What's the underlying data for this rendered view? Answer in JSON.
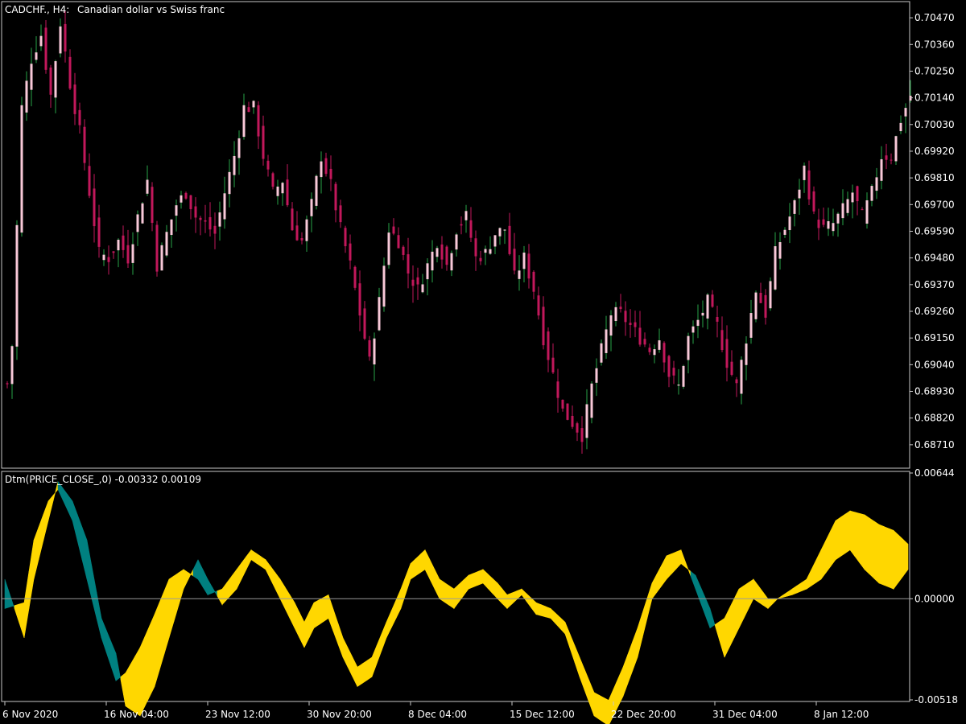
{
  "header": {
    "symbol": "CADCHF., H4:",
    "description": "Canadian dollar vs Swiss franc"
  },
  "indicator": {
    "label": "Dtm(PRICE_CLOSE_,0) -0.00332 0.00109"
  },
  "colors": {
    "background": "#000000",
    "frame": "#c8c8c8",
    "bull_candle": "#27a348",
    "bear_candle": "#c2185b",
    "doji_wick": "#f8c8d8",
    "fill_up": "#ffd700",
    "fill_down": "#008080",
    "zero_line": "#9a9a9a"
  },
  "chart_data": [
    {
      "type": "candlestick",
      "name": "price",
      "y_ticks": [
        "0.70470",
        "0.70360",
        "0.70250",
        "0.70140",
        "0.70030",
        "0.69920",
        "0.69810",
        "0.69700",
        "0.69590",
        "0.69480",
        "0.69370",
        "0.69260",
        "0.69150",
        "0.69040",
        "0.68930",
        "0.68820",
        "0.68710"
      ],
      "ylim": [
        0.6862,
        0.7053
      ],
      "close_path": [
        [
          0,
          0.6896
        ],
        [
          1,
          0.6912
        ],
        [
          3,
          0.701
        ],
        [
          5,
          0.703
        ],
        [
          7,
          0.704
        ],
        [
          9,
          0.7015
        ],
        [
          11,
          0.7045
        ],
        [
          13,
          0.702
        ],
        [
          15,
          0.7
        ],
        [
          17,
          0.6975
        ],
        [
          19,
          0.695
        ],
        [
          21,
          0.6948
        ],
        [
          23,
          0.6955
        ],
        [
          25,
          0.6948
        ],
        [
          27,
          0.6965
        ],
        [
          29,
          0.698
        ],
        [
          31,
          0.6945
        ],
        [
          33,
          0.6958
        ],
        [
          35,
          0.697
        ],
        [
          37,
          0.6975
        ],
        [
          39,
          0.6965
        ],
        [
          41,
          0.6962
        ],
        [
          43,
          0.6958
        ],
        [
          45,
          0.6975
        ],
        [
          47,
          0.699
        ],
        [
          49,
          0.701
        ],
        [
          51,
          0.701
        ],
        [
          53,
          0.699
        ],
        [
          55,
          0.6975
        ],
        [
          57,
          0.698
        ],
        [
          59,
          0.696
        ],
        [
          61,
          0.6955
        ],
        [
          63,
          0.697
        ],
        [
          65,
          0.699
        ],
        [
          67,
          0.6978
        ],
        [
          69,
          0.696
        ],
        [
          71,
          0.6945
        ],
        [
          73,
          0.6925
        ],
        [
          75,
          0.6905
        ],
        [
          77,
          0.693
        ],
        [
          79,
          0.696
        ],
        [
          81,
          0.6955
        ],
        [
          83,
          0.6942
        ],
        [
          85,
          0.6935
        ],
        [
          87,
          0.6945
        ],
        [
          89,
          0.6955
        ],
        [
          91,
          0.6945
        ],
        [
          93,
          0.696
        ],
        [
          95,
          0.6965
        ],
        [
          97,
          0.6948
        ],
        [
          99,
          0.695
        ],
        [
          101,
          0.6958
        ],
        [
          103,
          0.696
        ],
        [
          105,
          0.694
        ],
        [
          107,
          0.6948
        ],
        [
          109,
          0.6935
        ],
        [
          111,
          0.6915
        ],
        [
          113,
          0.69
        ],
        [
          115,
          0.6885
        ],
        [
          117,
          0.688
        ],
        [
          119,
          0.6875
        ],
        [
          121,
          0.6895
        ],
        [
          123,
          0.691
        ],
        [
          125,
          0.6925
        ],
        [
          127,
          0.6925
        ],
        [
          129,
          0.692
        ],
        [
          131,
          0.6915
        ],
        [
          133,
          0.691
        ],
        [
          135,
          0.6915
        ],
        [
          137,
          0.69
        ],
        [
          139,
          0.6895
        ],
        [
          141,
          0.6915
        ],
        [
          143,
          0.6922
        ],
        [
          145,
          0.693
        ],
        [
          147,
          0.692
        ],
        [
          149,
          0.6905
        ],
        [
          151,
          0.6895
        ],
        [
          153,
          0.6915
        ],
        [
          155,
          0.6935
        ],
        [
          157,
          0.6925
        ],
        [
          159,
          0.695
        ],
        [
          161,
          0.696
        ],
        [
          163,
          0.697
        ],
        [
          165,
          0.6985
        ],
        [
          167,
          0.6965
        ],
        [
          169,
          0.696
        ],
        [
          171,
          0.6962
        ],
        [
          173,
          0.6968
        ],
        [
          175,
          0.6975
        ],
        [
          177,
          0.6965
        ],
        [
          179,
          0.6975
        ],
        [
          181,
          0.699
        ],
        [
          183,
          0.699
        ],
        [
          185,
          0.7005
        ],
        [
          187,
          0.7015
        ]
      ]
    },
    {
      "type": "area",
      "name": "Dtm",
      "y_ticks": [
        "0.00644",
        "0.00000",
        "-0.00518"
      ],
      "ylim": [
        -0.00518,
        0.00644
      ],
      "line_a": [
        [
          0,
          -0.0005
        ],
        [
          4,
          -0.0002
        ],
        [
          6,
          0.003
        ],
        [
          9,
          0.005
        ],
        [
          11,
          0.0056
        ],
        [
          14,
          0.004
        ],
        [
          17,
          0.001
        ],
        [
          20,
          -0.002
        ],
        [
          23,
          -0.0042
        ],
        [
          25,
          -0.0038
        ],
        [
          28,
          -0.0025
        ],
        [
          31,
          -0.0008
        ],
        [
          34,
          0.001
        ],
        [
          37,
          0.0015
        ],
        [
          40,
          0.001
        ],
        [
          42,
          0.0002
        ],
        [
          45,
          0.0005
        ],
        [
          48,
          0.0015
        ],
        [
          51,
          0.0025
        ],
        [
          54,
          0.002
        ],
        [
          57,
          0.001
        ],
        [
          60,
          -0.0002
        ],
        [
          62,
          -0.0012
        ],
        [
          64,
          -0.0002
        ],
        [
          67,
          0.0002
        ],
        [
          70,
          -0.002
        ],
        [
          73,
          -0.0035
        ],
        [
          76,
          -0.003
        ],
        [
          79,
          -0.0012
        ],
        [
          82,
          0.0005
        ],
        [
          84,
          0.0018
        ],
        [
          87,
          0.0025
        ],
        [
          90,
          0.001
        ],
        [
          93,
          0.0005
        ],
        [
          96,
          0.0012
        ],
        [
          99,
          0.0015
        ],
        [
          102,
          0.0008
        ],
        [
          104,
          0.0002
        ],
        [
          107,
          0.0005
        ],
        [
          110,
          -0.0002
        ],
        [
          113,
          -0.0005
        ],
        [
          116,
          -0.0012
        ],
        [
          119,
          -0.003
        ],
        [
          122,
          -0.0048
        ],
        [
          125,
          -0.0052
        ],
        [
          128,
          -0.0035
        ],
        [
          131,
          -0.0015
        ],
        [
          134,
          0.0008
        ],
        [
          137,
          0.0022
        ],
        [
          140,
          0.0025
        ],
        [
          143,
          0.0005
        ],
        [
          146,
          -0.0015
        ],
        [
          149,
          -0.001
        ],
        [
          152,
          0.0005
        ],
        [
          155,
          0.001
        ],
        [
          158,
          0.0
        ],
        [
          160,
          0.0
        ],
        [
          163,
          0.0005
        ],
        [
          166,
          0.001
        ],
        [
          169,
          0.0025
        ],
        [
          172,
          0.004
        ],
        [
          175,
          0.0045
        ],
        [
          178,
          0.0043
        ],
        [
          181,
          0.0038
        ],
        [
          184,
          0.0035
        ],
        [
          187,
          0.0028
        ]
      ],
      "line_b": [
        [
          0,
          0.001
        ],
        [
          4,
          -0.002
        ],
        [
          6,
          0.001
        ],
        [
          9,
          0.004
        ],
        [
          11,
          0.006
        ],
        [
          14,
          0.005
        ],
        [
          17,
          0.003
        ],
        [
          20,
          -0.001
        ],
        [
          23,
          -0.0028
        ],
        [
          25,
          -0.0055
        ],
        [
          28,
          -0.006
        ],
        [
          31,
          -0.0045
        ],
        [
          34,
          -0.002
        ],
        [
          37,
          0.0005
        ],
        [
          40,
          0.002
        ],
        [
          42,
          0.001
        ],
        [
          45,
          -0.0003
        ],
        [
          48,
          0.0005
        ],
        [
          51,
          0.002
        ],
        [
          54,
          0.0015
        ],
        [
          57,
          0.0
        ],
        [
          60,
          -0.0015
        ],
        [
          62,
          -0.0025
        ],
        [
          64,
          -0.0015
        ],
        [
          67,
          -0.001
        ],
        [
          70,
          -0.003
        ],
        [
          73,
          -0.0045
        ],
        [
          76,
          -0.004
        ],
        [
          79,
          -0.002
        ],
        [
          82,
          -0.0005
        ],
        [
          84,
          0.001
        ],
        [
          87,
          0.0015
        ],
        [
          90,
          0.0
        ],
        [
          93,
          -0.0005
        ],
        [
          96,
          0.0005
        ],
        [
          99,
          0.0008
        ],
        [
          102,
          0.0
        ],
        [
          104,
          -0.0005
        ],
        [
          107,
          0.0002
        ],
        [
          110,
          -0.0008
        ],
        [
          113,
          -0.001
        ],
        [
          116,
          -0.0018
        ],
        [
          119,
          -0.004
        ],
        [
          122,
          -0.006
        ],
        [
          125,
          -0.0065
        ],
        [
          128,
          -0.005
        ],
        [
          131,
          -0.003
        ],
        [
          134,
          0.0
        ],
        [
          137,
          0.001
        ],
        [
          140,
          0.0018
        ],
        [
          143,
          0.0012
        ],
        [
          146,
          -0.0005
        ],
        [
          149,
          -0.003
        ],
        [
          152,
          -0.0015
        ],
        [
          155,
          0.0
        ],
        [
          158,
          -0.0005
        ],
        [
          160,
          0.0
        ],
        [
          163,
          0.0002
        ],
        [
          166,
          0.0005
        ],
        [
          169,
          0.001
        ],
        [
          172,
          0.002
        ],
        [
          175,
          0.0025
        ],
        [
          178,
          0.0015
        ],
        [
          181,
          0.0008
        ],
        [
          184,
          0.0005
        ],
        [
          187,
          0.0015
        ]
      ]
    }
  ],
  "x_ticks": [
    {
      "label": "6 Nov 2020",
      "i": 0
    },
    {
      "label": "16 Nov 04:00",
      "i": 21
    },
    {
      "label": "23 Nov 12:00",
      "i": 42
    },
    {
      "label": "30 Nov 20:00",
      "i": 63
    },
    {
      "label": "8 Dec 04:00",
      "i": 84
    },
    {
      "label": "15 Dec 12:00",
      "i": 105
    },
    {
      "label": "22 Dec 20:00",
      "i": 126
    },
    {
      "label": "31 Dec 04:00",
      "i": 147
    },
    {
      "label": "8 Jan 12:00",
      "i": 168
    }
  ]
}
